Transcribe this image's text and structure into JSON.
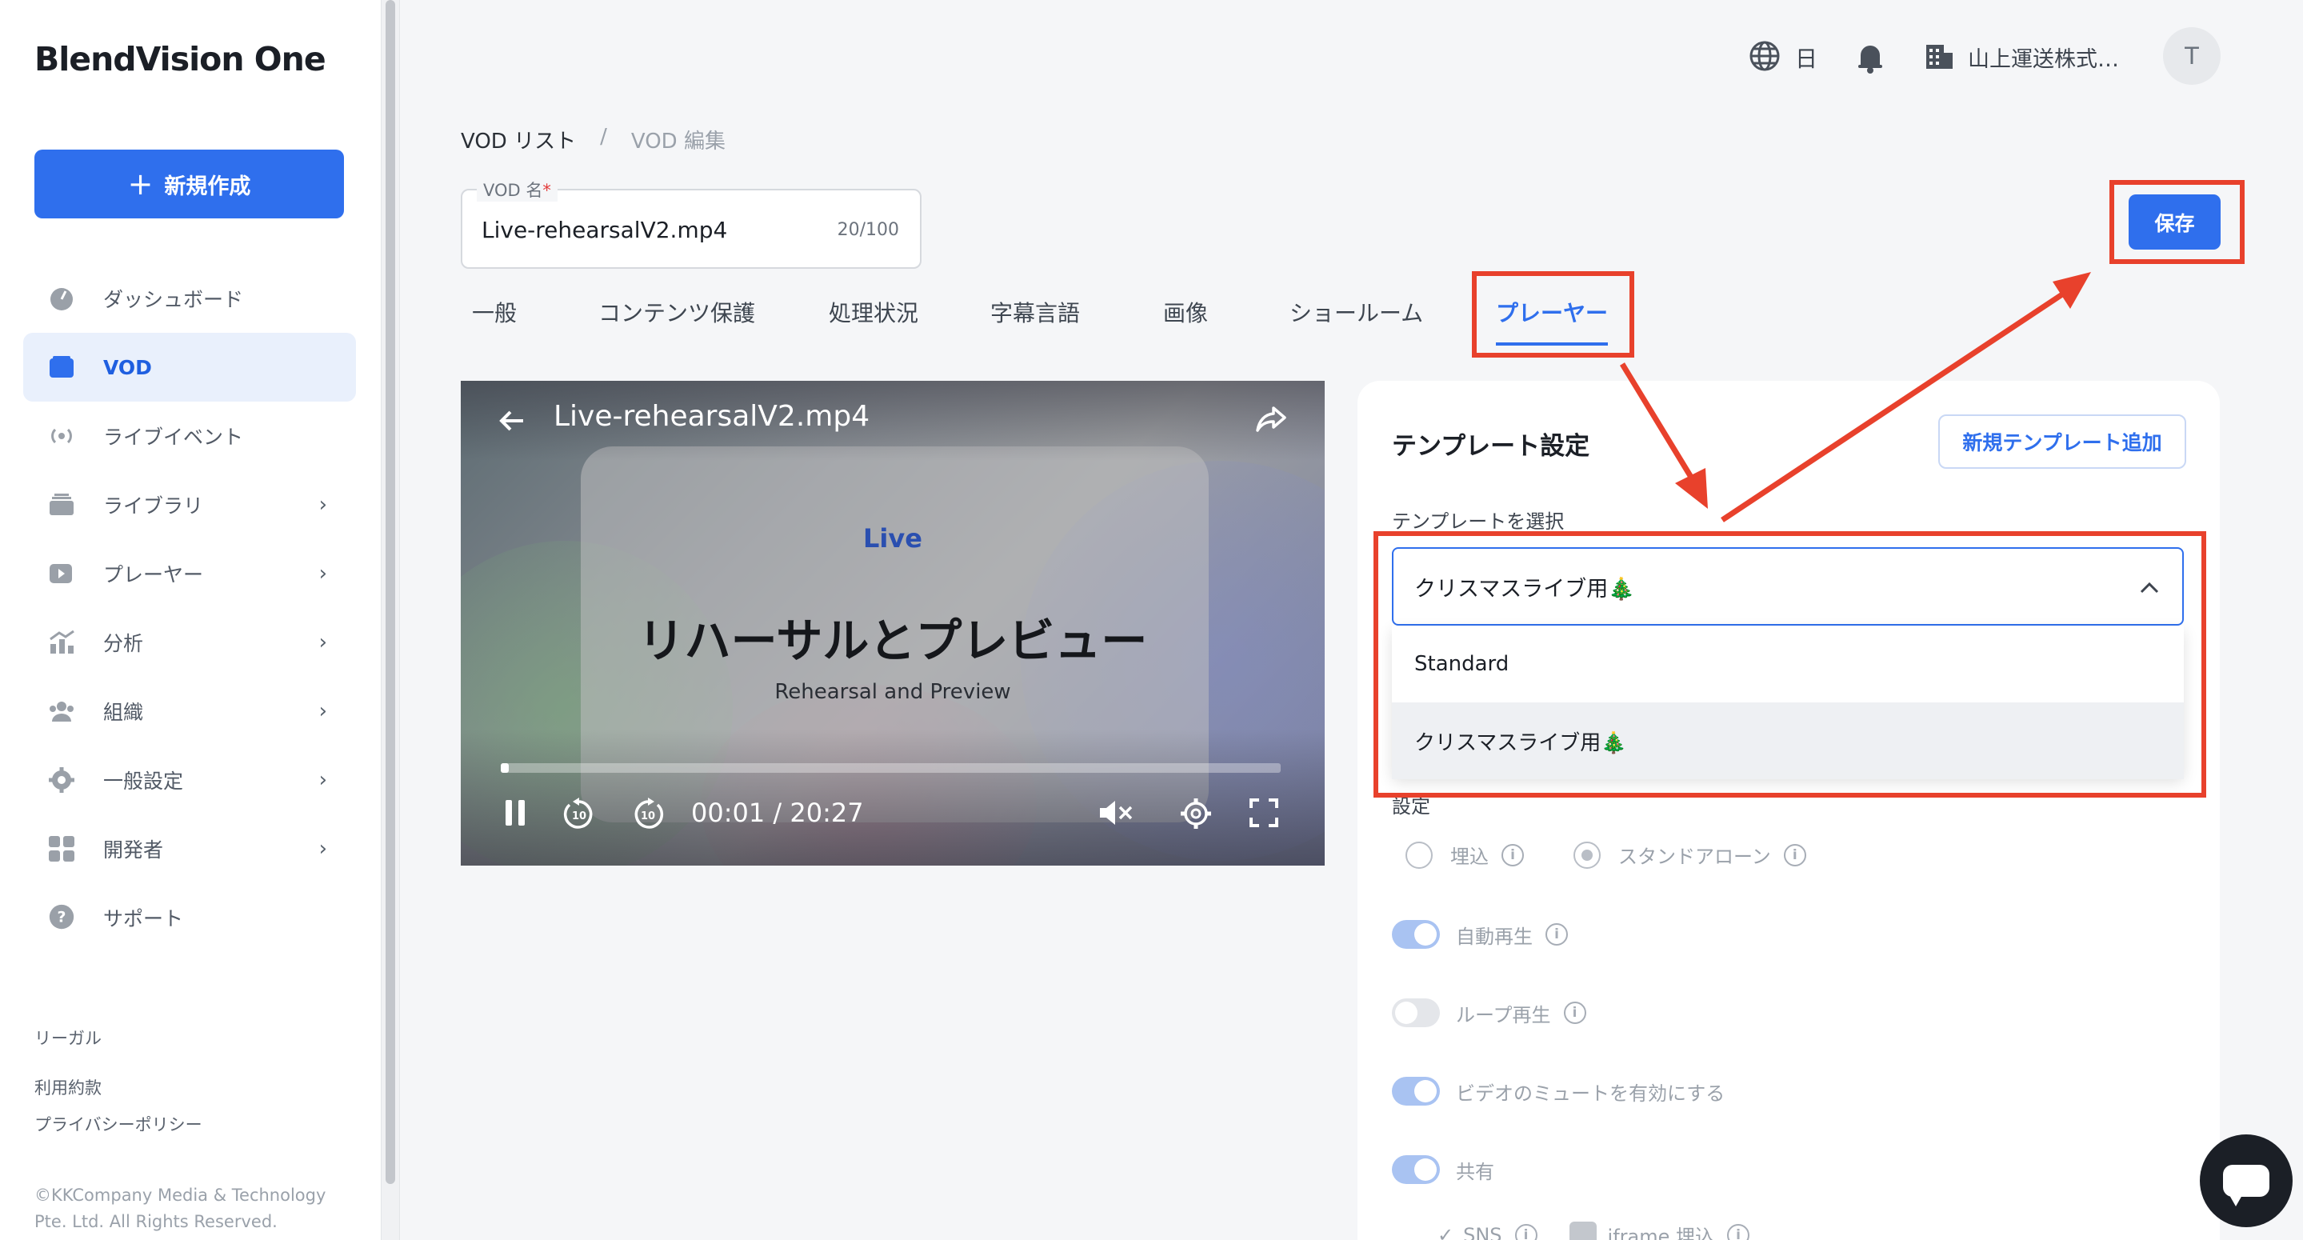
{
  "app": {
    "brand": "BlendVision One"
  },
  "sidebar": {
    "create_label": "新規作成",
    "items": [
      {
        "label": "ダッシュボード",
        "icon": "gauge-icon",
        "active": false,
        "has_children": false
      },
      {
        "label": "VOD",
        "icon": "video-icon",
        "active": true,
        "has_children": false
      },
      {
        "label": "ライブイベント",
        "icon": "broadcast-icon",
        "active": false,
        "has_children": false
      },
      {
        "label": "ライブラリ",
        "icon": "library-icon",
        "active": false,
        "has_children": true
      },
      {
        "label": "プレーヤー",
        "icon": "player-icon",
        "active": false,
        "has_children": true
      },
      {
        "label": "分析",
        "icon": "analytics-icon",
        "active": false,
        "has_children": true
      },
      {
        "label": "組織",
        "icon": "organization-icon",
        "active": false,
        "has_children": true
      },
      {
        "label": "一般設定",
        "icon": "gear-icon",
        "active": false,
        "has_children": true
      },
      {
        "label": "開発者",
        "icon": "developer-icon",
        "active": false,
        "has_children": true
      },
      {
        "label": "サポート",
        "icon": "help-icon",
        "active": false,
        "has_children": false
      }
    ],
    "legal": {
      "heading": "リーガル",
      "terms": "利用約款",
      "privacy": "プライバシーポリシー"
    },
    "copyright": "©KKCompany Media & Technology Pte. Ltd. All Rights Reserved."
  },
  "header": {
    "language": "日",
    "organization": "山上運送株式…",
    "avatar_initial": "T"
  },
  "breadcrumb": {
    "parent": "VOD リスト",
    "separator": "/",
    "current": "VOD 編集"
  },
  "vod_name": {
    "label": "VOD 名",
    "required_mark": "*",
    "value": "Live-rehearsalV2.mp4",
    "counter": "20/100"
  },
  "save_label": "保存",
  "tabs": [
    {
      "label": "一般",
      "active": false
    },
    {
      "label": "コンテンツ保護",
      "active": false
    },
    {
      "label": "処理状況",
      "active": false
    },
    {
      "label": "字幕言語",
      "active": false
    },
    {
      "label": "画像",
      "active": false
    },
    {
      "label": "ショールーム",
      "active": false
    },
    {
      "label": "プレーヤー",
      "active": true
    }
  ],
  "player": {
    "title": "Live-rehearsalV2.mp4",
    "live_label": "Live",
    "headline": "リハーサルとプレビュー",
    "subheadline": "Rehearsal and Preview",
    "current_time": "00:01",
    "time_separator": "/",
    "duration": "20:27",
    "progress_fraction": 0.01
  },
  "template_panel": {
    "title": "テンプレート設定",
    "add_button": "新規テンプレート追加",
    "select_label": "テンプレートを選択",
    "selected": "クリスマスライブ用🎄",
    "options": [
      "Standard",
      "クリスマスライブ用🎄"
    ],
    "settings_label": "設定",
    "embed_options": [
      {
        "label": "埋込",
        "checked": false
      },
      {
        "label": "スタンドアローン",
        "checked": true
      }
    ],
    "toggles": [
      {
        "label": "自動再生",
        "on": true
      },
      {
        "label": "ループ再生",
        "on": false
      },
      {
        "label": "ビデオのミュートを有効にする",
        "on": true
      },
      {
        "label": "共有",
        "on": true
      }
    ],
    "share_suboptions": [
      "SNS",
      "iframe 埋込"
    ]
  },
  "colors": {
    "primary": "#2f6fed",
    "annotation": "#e8412c",
    "active_nav_bg": "#e9f0fc"
  }
}
